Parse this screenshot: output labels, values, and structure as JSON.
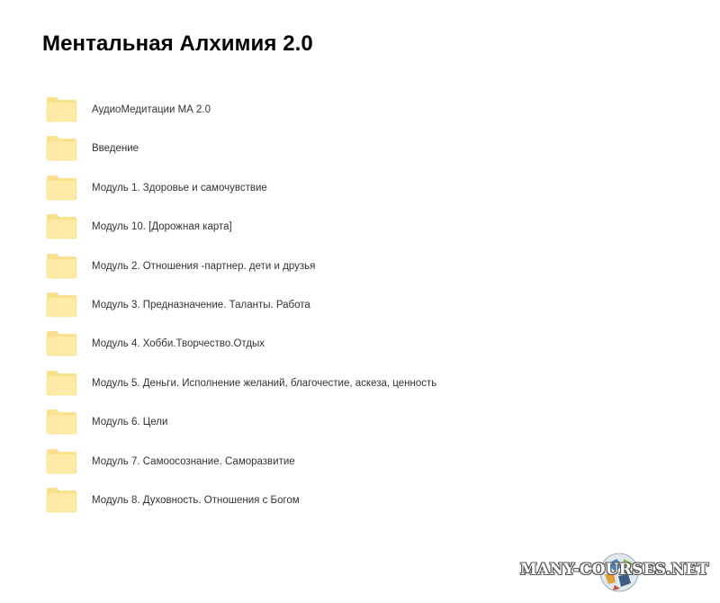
{
  "page": {
    "title": "Ментальная Алхимия 2.0"
  },
  "folders": [
    {
      "label": "АудиоМедитации МА 2.0"
    },
    {
      "label": "Введение"
    },
    {
      "label": "Модуль 1. Здоровье и самочувствие"
    },
    {
      "label": "Модуль 10. [Дорожная карта]"
    },
    {
      "label": "Модуль 2. Отношения -партнер. дети и друзья"
    },
    {
      "label": "Модуль 3. Предназначение. Таланты. Работа"
    },
    {
      "label": "Модуль 4. Хобби.Творчество.Отдых"
    },
    {
      "label": "Модуль 5. Деньги. Исполнение желаний, благочестие, аскеза, ценность"
    },
    {
      "label": "Модуль 6. Цели"
    },
    {
      "label": "Модуль 7. Самоосознание. Саморазвитие"
    },
    {
      "label": "Модуль 8. Духовность. Отношения с Богом"
    }
  ],
  "icons": {
    "folder": "folder-icon",
    "watermark_globe": "globe-icon"
  },
  "colors": {
    "folder_fill": "#FFEAA6",
    "folder_tab": "#FBE08E",
    "folder_stroke": "#F5D77E",
    "title": "#000000",
    "text": "#333333"
  },
  "watermark": {
    "text": "MANY-COURSES.NET"
  }
}
